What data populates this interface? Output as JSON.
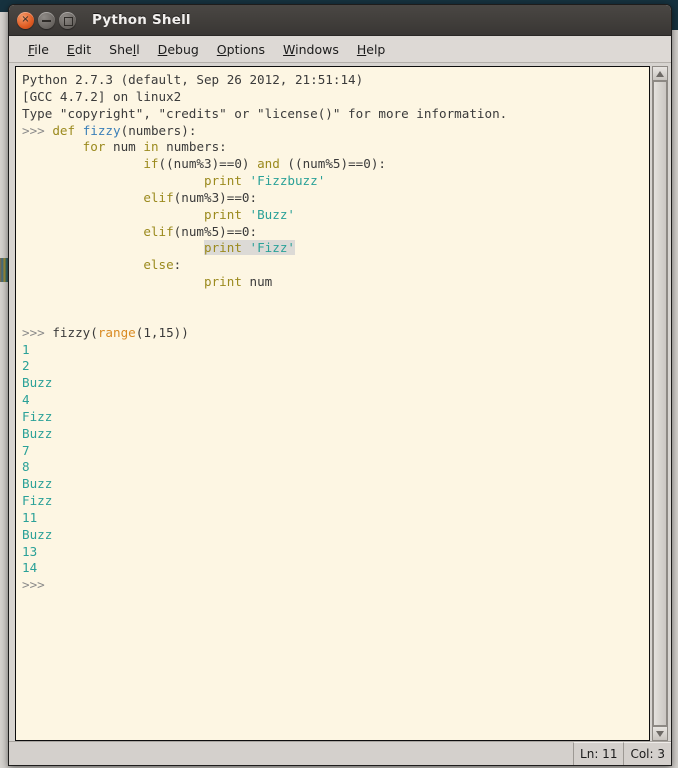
{
  "window": {
    "title": "Python Shell",
    "controls": [
      {
        "name": "close",
        "glyph": "×"
      },
      {
        "name": "minimize",
        "glyph": "–"
      },
      {
        "name": "maximize",
        "glyph": "□"
      }
    ]
  },
  "menubar": {
    "items": [
      {
        "label": "File",
        "mnemonic": "F"
      },
      {
        "label": "Edit",
        "mnemonic": "E"
      },
      {
        "label": "Shell",
        "mnemonic": "l"
      },
      {
        "label": "Debug",
        "mnemonic": "D"
      },
      {
        "label": "Options",
        "mnemonic": "O"
      },
      {
        "label": "Windows",
        "mnemonic": "W"
      },
      {
        "label": "Help",
        "mnemonic": "H"
      }
    ]
  },
  "shell": {
    "banner": [
      "Python 2.7.3 (default, Sep 26 2012, 21:51:14)",
      "[GCC 4.7.2] on linux2",
      "Type \"copyright\", \"credits\" or \"license()\" for more information."
    ],
    "lines": [
      {
        "id": "l1",
        "segments": [
          {
            "t": ">>> ",
            "c": "prompt"
          },
          {
            "t": "def ",
            "c": "kw"
          },
          {
            "t": "fizzy",
            "c": "def"
          },
          {
            "t": "(numbers):",
            "c": "plain"
          }
        ]
      },
      {
        "id": "l2",
        "segments": [
          {
            "t": "        ",
            "c": "plain"
          },
          {
            "t": "for ",
            "c": "kw"
          },
          {
            "t": "num ",
            "c": "plain"
          },
          {
            "t": "in ",
            "c": "kw"
          },
          {
            "t": "numbers:",
            "c": "plain"
          }
        ]
      },
      {
        "id": "l3",
        "segments": [
          {
            "t": "                ",
            "c": "plain"
          },
          {
            "t": "if",
            "c": "kw"
          },
          {
            "t": "((num%3)==0) ",
            "c": "plain"
          },
          {
            "t": "and ",
            "c": "kw"
          },
          {
            "t": "((num%5)==0):",
            "c": "plain"
          }
        ]
      },
      {
        "id": "l4",
        "segments": [
          {
            "t": "                        ",
            "c": "plain"
          },
          {
            "t": "print ",
            "c": "kw"
          },
          {
            "t": "'Fizzbuzz'",
            "c": "str"
          }
        ]
      },
      {
        "id": "l5",
        "segments": [
          {
            "t": "                ",
            "c": "plain"
          },
          {
            "t": "elif",
            "c": "kw"
          },
          {
            "t": "(num%3)==0:",
            "c": "plain"
          }
        ]
      },
      {
        "id": "l6",
        "segments": [
          {
            "t": "                        ",
            "c": "plain"
          },
          {
            "t": "print ",
            "c": "kw"
          },
          {
            "t": "'Buzz'",
            "c": "str"
          }
        ]
      },
      {
        "id": "l7",
        "segments": [
          {
            "t": "                ",
            "c": "plain"
          },
          {
            "t": "elif",
            "c": "kw"
          },
          {
            "t": "(num%5)==0:",
            "c": "plain"
          }
        ]
      },
      {
        "id": "l8",
        "segments": [
          {
            "t": "                        ",
            "c": "plain"
          },
          {
            "t": "print ",
            "c": "kw",
            "sel": true
          },
          {
            "t": "'Fizz'",
            "c": "str",
            "sel": true
          }
        ]
      },
      {
        "id": "l9",
        "segments": [
          {
            "t": "                ",
            "c": "plain"
          },
          {
            "t": "else",
            "c": "kw"
          },
          {
            "t": ":",
            "c": "plain"
          }
        ]
      },
      {
        "id": "l10",
        "segments": [
          {
            "t": "                        ",
            "c": "plain"
          },
          {
            "t": "print ",
            "c": "kw"
          },
          {
            "t": "num",
            "c": "plain"
          }
        ]
      },
      {
        "id": "l11",
        "segments": []
      },
      {
        "id": "l12",
        "segments": []
      },
      {
        "id": "l13",
        "segments": [
          {
            "t": ">>> ",
            "c": "prompt"
          },
          {
            "t": "fizzy(",
            "c": "plain"
          },
          {
            "t": "range",
            "c": "builtin"
          },
          {
            "t": "(1,15))",
            "c": "plain"
          }
        ]
      },
      {
        "id": "l14",
        "segments": [
          {
            "t": "1",
            "c": "out"
          }
        ]
      },
      {
        "id": "l15",
        "segments": [
          {
            "t": "2",
            "c": "out"
          }
        ]
      },
      {
        "id": "l16",
        "segments": [
          {
            "t": "Buzz",
            "c": "out"
          }
        ]
      },
      {
        "id": "l17",
        "segments": [
          {
            "t": "4",
            "c": "out"
          }
        ]
      },
      {
        "id": "l18",
        "segments": [
          {
            "t": "Fizz",
            "c": "out"
          }
        ]
      },
      {
        "id": "l19",
        "segments": [
          {
            "t": "Buzz",
            "c": "out"
          }
        ]
      },
      {
        "id": "l20",
        "segments": [
          {
            "t": "7",
            "c": "out"
          }
        ]
      },
      {
        "id": "l21",
        "segments": [
          {
            "t": "8",
            "c": "out"
          }
        ]
      },
      {
        "id": "l22",
        "segments": [
          {
            "t": "Buzz",
            "c": "out"
          }
        ]
      },
      {
        "id": "l23",
        "segments": [
          {
            "t": "Fizz",
            "c": "out"
          }
        ]
      },
      {
        "id": "l24",
        "segments": [
          {
            "t": "11",
            "c": "out"
          }
        ]
      },
      {
        "id": "l25",
        "segments": [
          {
            "t": "Buzz",
            "c": "out"
          }
        ]
      },
      {
        "id": "l26",
        "segments": [
          {
            "t": "13",
            "c": "out"
          }
        ]
      },
      {
        "id": "l27",
        "segments": [
          {
            "t": "14",
            "c": "out"
          }
        ]
      },
      {
        "id": "l28",
        "segments": [
          {
            "t": ">>>",
            "c": "prompt"
          }
        ]
      }
    ]
  },
  "scrollbar": {
    "up_arrow_icon": "triangle-up-icon",
    "down_arrow_icon": "triangle-down-icon"
  },
  "statusbar": {
    "line_label": "Ln: 11",
    "col_label": "Col: 3"
  },
  "colors": {
    "text_background": "#fdf6e3",
    "keyword": "#9b8a1e",
    "function_name": "#3a7fb8",
    "builtin": "#d98a22",
    "string": "#2aa198",
    "output": "#2aa198",
    "prompt": "#8a8a8a",
    "selection": "#dcdad6",
    "titlebar": "#413e3b",
    "close_button": "#df5b22"
  }
}
